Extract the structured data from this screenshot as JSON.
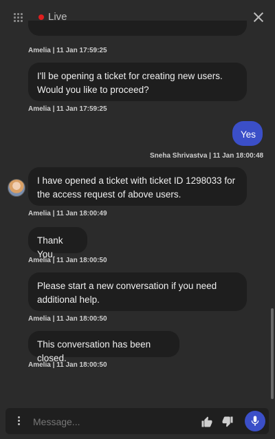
{
  "header": {
    "status_label": "Live",
    "live_color": "#e01e1e"
  },
  "messages": [
    {
      "sender": "Amelia",
      "text": "",
      "meta": "Amelia | 11 Jan 17:59:25"
    },
    {
      "sender": "Amelia",
      "text": "I'll be opening a ticket for creating new users. Would you like to proceed?",
      "meta": "Amelia | 11 Jan 17:59:25"
    },
    {
      "sender": "user",
      "text": "Yes",
      "meta": "Sneha Shrivastva | 11 Jan 18:00:48"
    },
    {
      "sender": "Amelia",
      "text": "I have opened a ticket with ticket ID 1298033 for the access request of above users.",
      "meta": "Amelia | 11 Jan 18:00:49"
    },
    {
      "sender": "Amelia",
      "text": "Thank You.",
      "meta": "Amelia | 11 Jan 18:00:50"
    },
    {
      "sender": "Amelia",
      "text": "Please start a new conversation if you need additional help.",
      "meta": "Amelia | 11 Jan 18:00:50"
    },
    {
      "sender": "Amelia",
      "text": "This conversation has been closed.",
      "meta": "Amelia | 11 Jan 18:00:50"
    }
  ],
  "composer": {
    "placeholder": "Message...",
    "accent_color": "#3b4fc8"
  },
  "icons": [
    "grid-icon",
    "close-icon",
    "avatar",
    "menu-dots-icon",
    "thumbs-up-icon",
    "thumbs-down-icon",
    "microphone-icon"
  ]
}
